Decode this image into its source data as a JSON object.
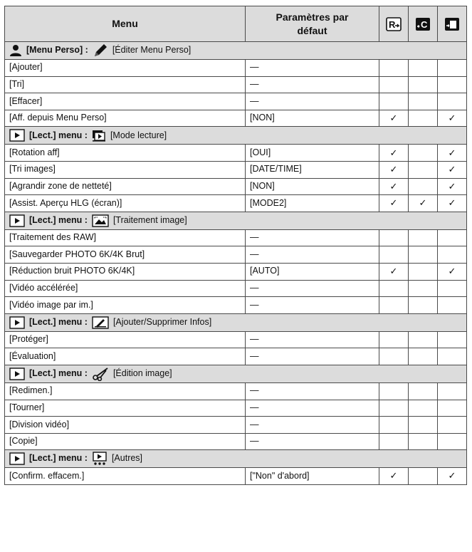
{
  "header": {
    "menu": "Menu",
    "defaults_line1": "Paramètres par",
    "defaults_line2": "défaut",
    "icons": [
      "reset-icon",
      "reset-custom-icon",
      "save-mode-icon"
    ]
  },
  "check_mark": "✓",
  "sections": [
    {
      "icon": "person-icon",
      "title": "[Menu Perso] :",
      "subicon": "pen-icon",
      "subtitle": "[Éditer Menu Perso]",
      "rows": [
        {
          "menu": "[Ajouter]",
          "default": "—",
          "checks": [
            "",
            "",
            ""
          ]
        },
        {
          "menu": "[Tri]",
          "default": "—",
          "checks": [
            "",
            "",
            ""
          ]
        },
        {
          "menu": "[Effacer]",
          "default": "—",
          "checks": [
            "",
            "",
            ""
          ]
        },
        {
          "menu": "[Aff. depuis Menu Perso]",
          "default": "[NON]",
          "checks": [
            "✓",
            "",
            "✓"
          ]
        }
      ]
    },
    {
      "icon": "play-icon",
      "title": "[Lect.] menu :",
      "subicon": "playback-mode-icon",
      "subtitle": "[Mode lecture]",
      "rows": [
        {
          "menu": "[Rotation aff]",
          "default": "[OUI]",
          "checks": [
            "✓",
            "",
            "✓"
          ]
        },
        {
          "menu": "[Tri images]",
          "default": "[DATE/TIME]",
          "checks": [
            "✓",
            "",
            "✓"
          ]
        },
        {
          "menu": "[Agrandir zone de netteté]",
          "default": "[NON]",
          "checks": [
            "✓",
            "",
            "✓"
          ]
        },
        {
          "menu": "[Assist. Aperçu HLG (écran)]",
          "default": "[MODE2]",
          "checks": [
            "✓",
            "✓",
            "✓"
          ]
        }
      ]
    },
    {
      "icon": "play-icon",
      "title": "[Lect.] menu :",
      "subicon": "image-processing-icon",
      "subtitle": "[Traitement image]",
      "rows": [
        {
          "menu": "[Traitement des RAW]",
          "default": "—",
          "checks": [
            "",
            "",
            ""
          ]
        },
        {
          "menu": "[Sauvegarder PHOTO 6K/4K Brut]",
          "default": "—",
          "checks": [
            "",
            "",
            ""
          ]
        },
        {
          "menu": "[Réduction bruit PHOTO 6K/4K]",
          "default": "[AUTO]",
          "checks": [
            "✓",
            "",
            "✓"
          ]
        },
        {
          "menu": "[Vidéo accélérée]",
          "default": "—",
          "checks": [
            "",
            "",
            ""
          ]
        },
        {
          "menu": "[Vidéo image par im.]",
          "default": "—",
          "checks": [
            "",
            "",
            ""
          ]
        }
      ]
    },
    {
      "icon": "play-icon",
      "title": "[Lect.] menu :",
      "subicon": "add-delete-info-icon",
      "subtitle": "[Ajouter/Supprimer Infos]",
      "rows": [
        {
          "menu": "[Protéger]",
          "default": "—",
          "checks": [
            "",
            "",
            ""
          ]
        },
        {
          "menu": "[Évaluation]",
          "default": "—",
          "checks": [
            "",
            "",
            ""
          ]
        }
      ]
    },
    {
      "icon": "play-icon",
      "title": "[Lect.] menu :",
      "subicon": "scissors-icon",
      "subtitle": "[Édition image]",
      "rows": [
        {
          "menu": "[Redimen.]",
          "default": "—",
          "checks": [
            "",
            "",
            ""
          ]
        },
        {
          "menu": "[Tourner]",
          "default": "—",
          "checks": [
            "",
            "",
            ""
          ]
        },
        {
          "menu": "[Division vidéo]",
          "default": "—",
          "checks": [
            "",
            "",
            ""
          ]
        },
        {
          "menu": "[Copie]",
          "default": "—",
          "checks": [
            "",
            "",
            ""
          ]
        }
      ]
    },
    {
      "icon": "play-icon",
      "title": "[Lect.] menu :",
      "subicon": "others-icon",
      "subtitle": "[Autres]",
      "rows": [
        {
          "menu": "[Confirm. effacem.]",
          "default": "[\"Non\" d'abord]",
          "checks": [
            "✓",
            "",
            "✓"
          ]
        }
      ]
    }
  ]
}
